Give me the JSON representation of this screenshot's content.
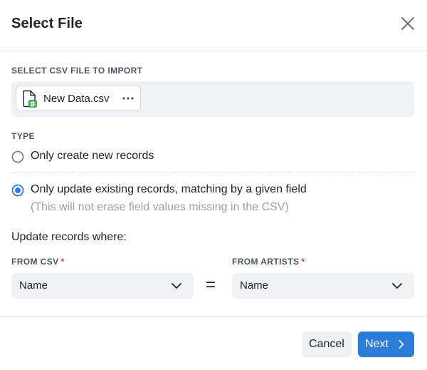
{
  "dialog": {
    "title": "Select File"
  },
  "file_section": {
    "label": "SELECT CSV FILE TO IMPORT",
    "file_name": "New Data.csv",
    "more_icon": "ellipsis-icon",
    "file_icon": "csv-file-icon"
  },
  "type_section": {
    "label": "TYPE",
    "options": [
      {
        "label": "Only create new records",
        "selected": false
      },
      {
        "label": "Only update existing records, matching by a given field",
        "selected": true,
        "hint": "(This will not erase field values missing in the CSV)"
      }
    ]
  },
  "match": {
    "heading": "Update records where:",
    "from_csv_label": "FROM CSV",
    "from_csv_value": "Name",
    "from_artists_label": "FROM ARTISTS",
    "from_artists_value": "Name",
    "equals": "=",
    "required_mark": "*"
  },
  "footer": {
    "cancel_label": "Cancel",
    "next_label": "Next"
  },
  "colors": {
    "accent": "#2b7bd8",
    "required": "#d1334a",
    "hint": "#9aa0a6",
    "field_bg": "#f0f1f4"
  }
}
